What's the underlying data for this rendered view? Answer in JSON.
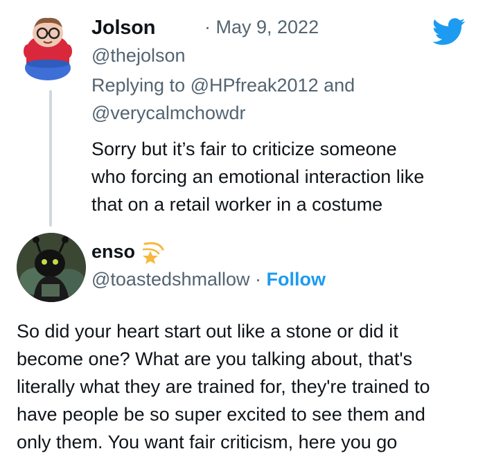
{
  "tweet_reply": {
    "name": "Jolson",
    "date": "· May 9, 2022",
    "handle": "@thejolson",
    "replying_line1": "Replying to @HPfreak2012 and",
    "replying_line2": "@verycalmchowdr",
    "text_lines": [
      "Sorry but it’s fair to criticize someone",
      "who forcing an emotional interaction like",
      "that on a retail worker in a costume"
    ]
  },
  "tweet_response": {
    "name": "enso",
    "handle": "@toastedshmallow",
    "separator": "·",
    "follow_label": "Follow",
    "text_lines": [
      "So did your heart start out like a stone or did it",
      "become one? What are you talking about, that's",
      "literally what they are trained for, they're trained to",
      "have people be so super excited to see them and",
      "only them. You want fair criticism, here you go"
    ]
  },
  "icons": {
    "brand": "twitter-bird-icon",
    "badge": "shooting-star-icon"
  },
  "colors": {
    "text": "#0f1419",
    "secondary": "#536471",
    "accent": "#1d9bf0",
    "thread_line": "#cfd9de"
  }
}
